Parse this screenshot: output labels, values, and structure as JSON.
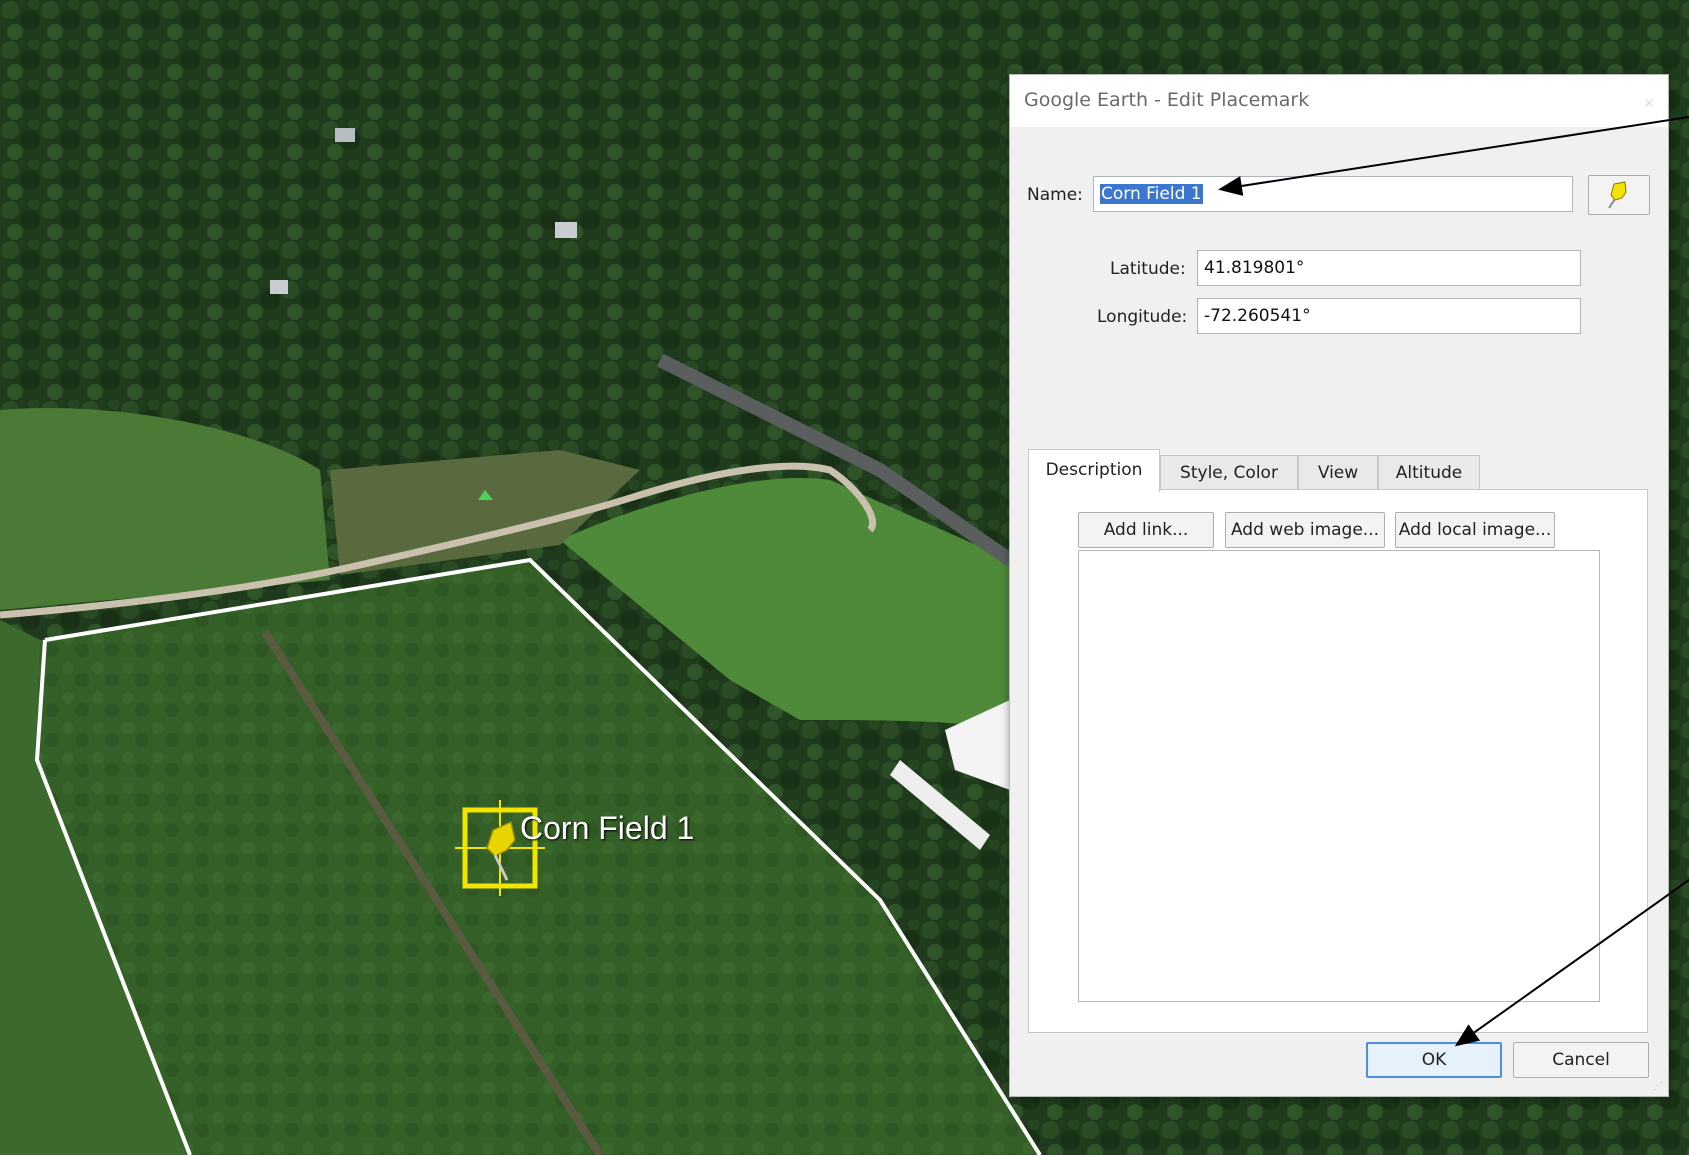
{
  "map": {
    "placemark_label": "Corn Field 1",
    "colors": {
      "forest": "#1f3a1c",
      "field": "#3b6a2c",
      "road": "#c9c0ad",
      "boundary": "#ffffff",
      "pin": "#f2e600"
    }
  },
  "dialog": {
    "title": "Google Earth - Edit Placemark",
    "close_icon": "close-icon",
    "name_label": "Name:",
    "name_value": "Corn Field 1",
    "pin_icon": "yellow-pushpin-icon",
    "latitude_label": "Latitude:",
    "latitude_value": "41.819801°",
    "longitude_label": "Longitude:",
    "longitude_value": "-72.260541°",
    "tabs": [
      "Description",
      "Style, Color",
      "View",
      "Altitude"
    ],
    "active_tab": "Description",
    "add_link_label": "Add link...",
    "add_web_image_label": "Add web image...",
    "add_local_image_label": "Add local image...",
    "description_value": "",
    "ok_label": "OK",
    "cancel_label": "Cancel"
  }
}
